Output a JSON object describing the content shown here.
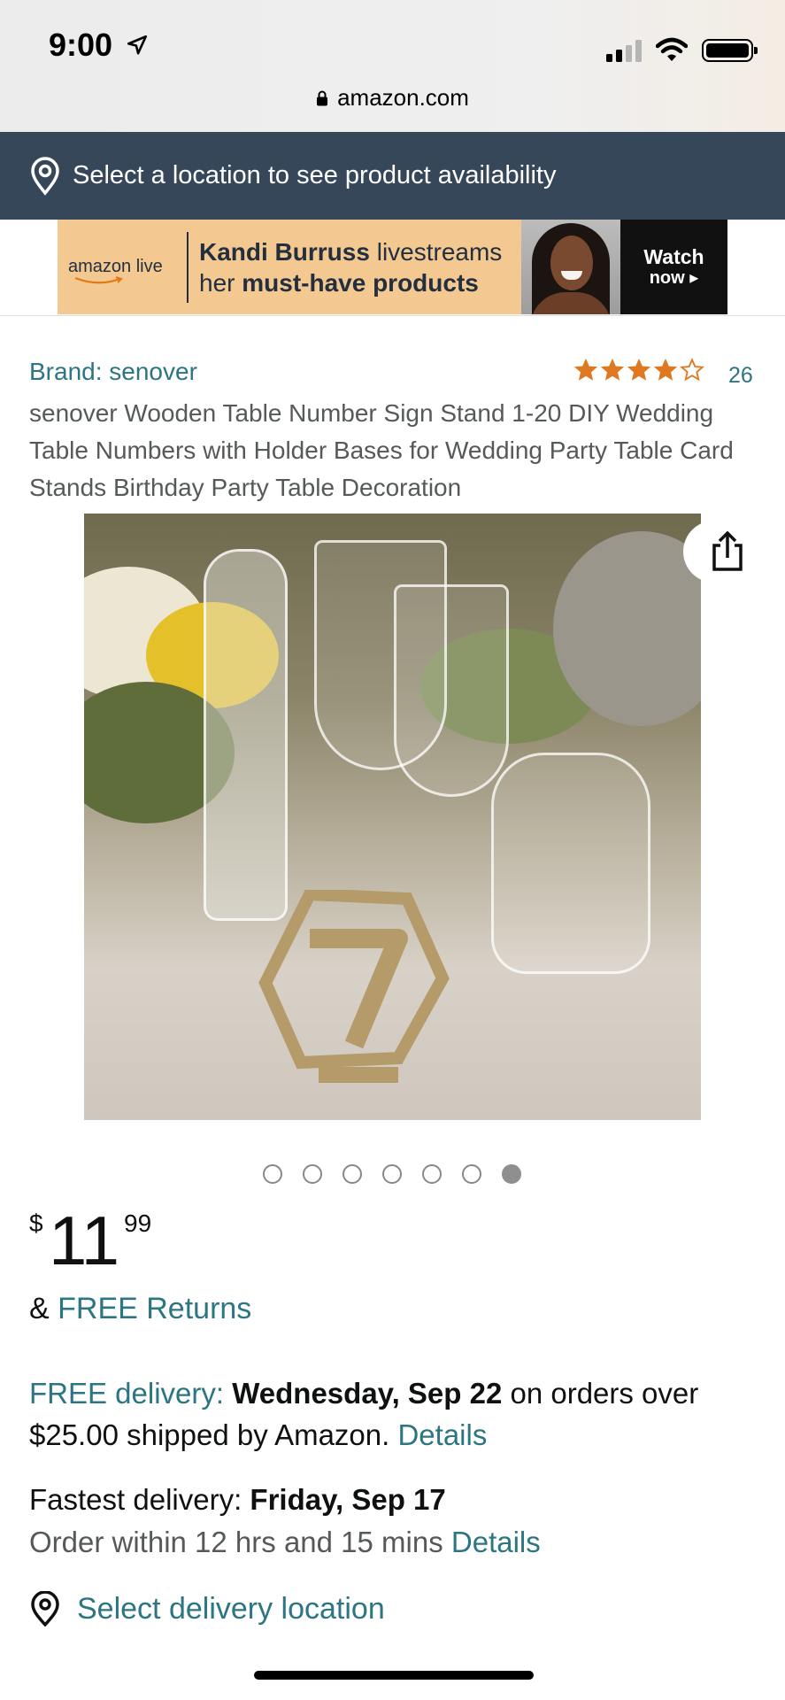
{
  "status_bar": {
    "time": "9:00"
  },
  "browser": {
    "url": "amazon.com"
  },
  "location_bar": {
    "text": "Select a location to see product availability"
  },
  "banner": {
    "logo_text": "amazon live",
    "line1_bold": "Kandi Burruss",
    "line1_rest": " livestreams",
    "line2_plain": "her ",
    "line2_bold": "must-have products",
    "cta_line1": "Watch",
    "cta_line2": "now ▸"
  },
  "product": {
    "brand": "Brand: senover",
    "rating_stars": 4.5,
    "review_count": "26",
    "title": "senover Wooden Table Number Sign Stand 1-20 DIY Wedding Table Numbers with Holder Bases for Wedding Party Table Card Stands Birthday Party Table Decoration",
    "image_count": 7,
    "active_image": 7
  },
  "price": {
    "currency": "$",
    "whole": "11",
    "fraction": "99"
  },
  "returns": {
    "prefix": "& ",
    "link": "FREE Returns"
  },
  "delivery": {
    "free_label": "FREE delivery:",
    "date": "Wednesday, Sep 22",
    "rest": " on orders over $25.00 shipped by Amazon. ",
    "details": "Details"
  },
  "fastest": {
    "label": "Fastest delivery: ",
    "date": "Friday, Sep 17",
    "order_within": "Order within 12 hrs and 15 mins ",
    "details": "Details"
  },
  "delivery_location": {
    "text": "Select delivery location"
  },
  "colors": {
    "link": "#2c7583",
    "location_bar": "#37475a",
    "star": "#de7921",
    "banner_bg": "#f3c891"
  }
}
